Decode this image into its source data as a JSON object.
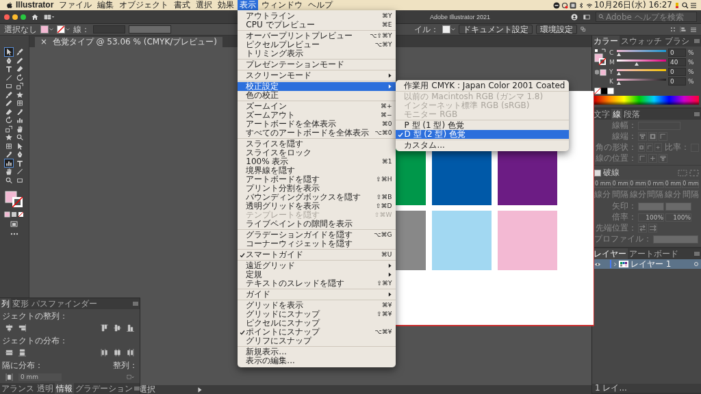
{
  "menubar": {
    "app": "Illustrator",
    "items": [
      {
        "label": "ファイル",
        "selected": false
      },
      {
        "label": "編集",
        "selected": false
      },
      {
        "label": "オブジェクト",
        "selected": false
      },
      {
        "label": "書式",
        "selected": false
      },
      {
        "label": "選択",
        "selected": false
      },
      {
        "label": "効果",
        "selected": false
      },
      {
        "label": "表示",
        "selected": true
      },
      {
        "label": "ウィンドウ",
        "selected": false
      },
      {
        "label": "ヘルプ",
        "selected": false
      }
    ],
    "clock": "10月26日(水) 16:27"
  },
  "view_menu": {
    "groups": [
      [
        {
          "label": "アウトライン",
          "shortcut": "⌘Y",
          "submenu": false,
          "checked": false,
          "disabled": false,
          "selected": false
        },
        {
          "label": "CPU でプレビュー",
          "shortcut": "⌘E",
          "submenu": false,
          "checked": false,
          "disabled": false,
          "selected": false
        }
      ],
      [
        {
          "label": "オーバープリントプレビュー",
          "shortcut": "⌥⇧⌘Y",
          "submenu": false,
          "checked": false,
          "disabled": false,
          "selected": false
        },
        {
          "label": "ピクセルプレビュー",
          "shortcut": "⌥⌘Y",
          "submenu": false,
          "checked": false,
          "disabled": false,
          "selected": false
        },
        {
          "label": "トリミング表示",
          "submenu": false,
          "checked": false,
          "disabled": false,
          "selected": false
        }
      ],
      [
        {
          "label": "プレゼンテーションモード",
          "submenu": false,
          "checked": false,
          "disabled": false,
          "selected": false
        }
      ],
      [
        {
          "label": "スクリーンモード",
          "submenu": true,
          "checked": false,
          "disabled": false,
          "selected": false
        }
      ],
      [
        {
          "label": "校正設定",
          "submenu": true,
          "checked": false,
          "disabled": false,
          "selected": true
        },
        {
          "label": "色の校正",
          "submenu": false,
          "checked": false,
          "disabled": false,
          "selected": false
        }
      ],
      [
        {
          "label": "ズームイン",
          "shortcut": "⌘+",
          "submenu": false,
          "checked": false,
          "disabled": false,
          "selected": false
        },
        {
          "label": "ズームアウト",
          "shortcut": "⌘−",
          "submenu": false,
          "checked": false,
          "disabled": false,
          "selected": false
        },
        {
          "label": "アートボードを全体表示",
          "shortcut": "⌘0",
          "submenu": false,
          "checked": false,
          "disabled": false,
          "selected": false
        },
        {
          "label": "すべてのアートボードを全体表示",
          "shortcut": "⌥⌘0",
          "submenu": false,
          "checked": false,
          "disabled": false,
          "selected": false
        }
      ],
      [
        {
          "label": "スライスを隠す",
          "submenu": false,
          "checked": false,
          "disabled": false,
          "selected": false
        },
        {
          "label": "スライスをロック",
          "submenu": false,
          "checked": false,
          "disabled": false,
          "selected": false
        },
        {
          "label": "100% 表示",
          "shortcut": "⌘1",
          "submenu": false,
          "checked": false,
          "disabled": false,
          "selected": false
        },
        {
          "label": "境界線を隠す",
          "submenu": false,
          "checked": false,
          "disabled": false,
          "selected": false
        },
        {
          "label": "アートボードを隠す",
          "shortcut": "⇧⌘H",
          "submenu": false,
          "checked": false,
          "disabled": false,
          "selected": false
        },
        {
          "label": "プリント分割を表示",
          "submenu": false,
          "checked": false,
          "disabled": false,
          "selected": false
        },
        {
          "label": "バウンディングボックスを隠す",
          "shortcut": "⇧⌘B",
          "submenu": false,
          "checked": false,
          "disabled": false,
          "selected": false
        },
        {
          "label": "透明グリッドを表示",
          "shortcut": "⇧⌘D",
          "submenu": false,
          "checked": false,
          "disabled": false,
          "selected": false
        },
        {
          "label": "テンプレートを隠す",
          "shortcut": "⇧⌘W",
          "submenu": false,
          "checked": false,
          "disabled": true,
          "selected": false
        },
        {
          "label": "ライブペイントの隙間を表示",
          "submenu": false,
          "checked": false,
          "disabled": false,
          "selected": false
        }
      ],
      [
        {
          "label": "グラデーションガイドを隠す",
          "shortcut": "⌥⌘G",
          "submenu": false,
          "checked": false,
          "disabled": false,
          "selected": false
        },
        {
          "label": "コーナーウィジェットを隠す",
          "submenu": false,
          "checked": false,
          "disabled": false,
          "selected": false
        }
      ],
      [
        {
          "label": "スマートガイド",
          "shortcut": "⌘U",
          "submenu": false,
          "checked": true,
          "disabled": false,
          "selected": false
        }
      ],
      [
        {
          "label": "遠近グリッド",
          "submenu": true,
          "checked": false,
          "disabled": false,
          "selected": false
        },
        {
          "label": "定規",
          "submenu": true,
          "checked": false,
          "disabled": false,
          "selected": false
        },
        {
          "label": "テキストのスレッドを隠す",
          "shortcut": "⇧⌘Y",
          "submenu": false,
          "checked": false,
          "disabled": false,
          "selected": false
        }
      ],
      [
        {
          "label": "ガイド",
          "submenu": true,
          "checked": false,
          "disabled": false,
          "selected": false
        }
      ],
      [
        {
          "label": "グリッドを表示",
          "shortcut": "⌘¥",
          "submenu": false,
          "checked": false,
          "disabled": false,
          "selected": false
        },
        {
          "label": "グリッドにスナップ",
          "shortcut": "⇧⌘¥",
          "submenu": false,
          "checked": false,
          "disabled": false,
          "selected": false
        },
        {
          "label": "ピクセルにスナップ",
          "submenu": false,
          "checked": false,
          "disabled": false,
          "selected": false
        },
        {
          "label": "ポイントにスナップ",
          "shortcut": "⌥⌘¥",
          "submenu": false,
          "checked": true,
          "disabled": false,
          "selected": false
        },
        {
          "label": "グリフにスナップ",
          "submenu": false,
          "checked": false,
          "disabled": false,
          "selected": false
        }
      ],
      [
        {
          "label": "新規表示...",
          "submenu": false,
          "checked": false,
          "disabled": false,
          "selected": false
        },
        {
          "label": "表示の編集...",
          "submenu": false,
          "checked": false,
          "disabled": false,
          "selected": false
        }
      ]
    ],
    "submenu": {
      "groups": [
        [
          {
            "label": "作業用 CMYK : Japan Color 2001 Coated",
            "checked": false,
            "disabled": false,
            "selected": false
          }
        ],
        [
          {
            "label": "以前の Macintosh RGB (ガンマ 1.8)",
            "checked": false,
            "disabled": true,
            "selected": false
          },
          {
            "label": "インターネット標準 RGB (sRGB)",
            "checked": false,
            "disabled": true,
            "selected": false
          },
          {
            "label": "モニター RGB",
            "checked": false,
            "disabled": true,
            "selected": false
          }
        ],
        [
          {
            "label": "P 型 (1 型) 色覚",
            "checked": false,
            "disabled": false,
            "selected": false
          },
          {
            "label": "D 型 (2 型) 色覚",
            "checked": true,
            "disabled": false,
            "selected": true
          }
        ],
        [
          {
            "label": "カスタム...",
            "checked": false,
            "disabled": false,
            "selected": false
          }
        ]
      ]
    }
  },
  "window": {
    "title": "Adobe Illustrator 2021",
    "search": {
      "placeholder": "Adobe ヘルプを検索"
    }
  },
  "control_bar": {
    "selection": "選択なし",
    "stroke_label": "線：",
    "style_label": "イル：",
    "buttons": [
      "ドキュメント設定",
      "環境設定"
    ]
  },
  "document_tab": {
    "close": "×",
    "title": "色覚タイプ @ 53.06 % (CMYK/プレビュー)"
  },
  "tools": [
    {
      "selected": true
    },
    {
      "selected": false
    },
    {
      "selected": false
    },
    {
      "selected": false
    },
    {
      "selected": false
    },
    {
      "selected": false
    },
    {
      "selected": false
    },
    {
      "selected": false
    },
    {
      "selected": false
    },
    {
      "selected": false
    },
    {
      "selected": false
    },
    {
      "selected": false
    },
    {
      "selected": false
    },
    {
      "selected": false
    },
    {
      "selected": false
    },
    {
      "selected": false
    },
    {
      "selected": false
    },
    {
      "selected": false
    },
    {
      "selected": false
    },
    {
      "selected": false
    },
    {
      "selected": false
    },
    {
      "selected": false
    },
    {
      "selected": false
    },
    {
      "selected": false
    },
    {
      "selected": false
    },
    {
      "selected": false
    },
    {
      "selected": true
    },
    {
      "selected": false
    },
    {
      "selected": false
    },
    {
      "selected": false
    },
    {
      "selected": false
    },
    {
      "selected": false
    }
  ],
  "artboard": {
    "swatches": [
      {
        "color": "#00974a"
      },
      {
        "color": "#0059a8"
      },
      {
        "color": "#6c1c84"
      },
      {
        "color": "#888888"
      },
      {
        "color": "#a2d8f2"
      },
      {
        "color": "#f3b9d3"
      }
    ]
  },
  "color_panel": {
    "tabs": [
      {
        "label": "カラー",
        "selected": true
      },
      {
        "label": "スウォッチ",
        "selected": false
      },
      {
        "label": "ブラシ",
        "selected": false
      }
    ],
    "channels": [
      {
        "name": "C",
        "value": "0",
        "unit": "%",
        "level": 0
      },
      {
        "name": "M",
        "value": "40",
        "unit": "%",
        "level": 0.4
      },
      {
        "name": "Y",
        "value": "0",
        "unit": "%",
        "level": 0
      },
      {
        "name": "K",
        "value": "0",
        "unit": "%",
        "level": 0
      }
    ]
  },
  "stroke_panel": {
    "disabled": true,
    "tabs": [
      {
        "label": "文字",
        "selected": false
      },
      {
        "label": "線",
        "selected": true
      },
      {
        "label": "段落",
        "selected": false
      }
    ],
    "weight_label": "線幅：",
    "cap_label": "線端：",
    "corner_label": "角の形状：",
    "limit_label": "比率：",
    "align_label": "線の位置：",
    "dash": {
      "label": "破線",
      "checked": false
    },
    "dash_fields": [
      {
        "value": "0 mm",
        "label": "線分"
      },
      {
        "value": "0 mm",
        "label": "間隔"
      },
      {
        "value": "0 mm",
        "label": "線分"
      },
      {
        "value": "0 mm",
        "label": "間隔"
      },
      {
        "value": "0 mm",
        "label": "線分"
      },
      {
        "value": "0 mm",
        "label": "間隔"
      }
    ],
    "arrow_label": "矢印：",
    "scale_label": "倍率：",
    "scales": [
      "100%",
      "100%"
    ],
    "tip_label": "先端位置：",
    "profile_label": "プロファイル："
  },
  "layers_panel": {
    "tabs": [
      {
        "label": "レイヤー",
        "selected": true
      },
      {
        "label": "アートボード",
        "selected": false
      }
    ],
    "layers": [
      {
        "name": "レイヤー 1",
        "selected": true
      }
    ],
    "status": "1 レイ..."
  },
  "align_panel": {
    "tabs": [
      {
        "label": "列",
        "selected": true
      },
      {
        "label": "変形",
        "selected": false
      },
      {
        "label": "パスファインダー",
        "selected": false
      }
    ],
    "align_label": "ジェクトの整列：",
    "distribute_label": "ジェクトの分布：",
    "spacing_label": "隔に分布：",
    "align_to_label": "整列：",
    "spacing_value": "0 mm",
    "bottom_tabs": [
      {
        "label": "アランス",
        "selected": false
      },
      {
        "label": "透明",
        "selected": false
      },
      {
        "label": "情報",
        "selected": true
      },
      {
        "label": "グラデーション",
        "selected": false
      }
    ]
  },
  "status_bar": {
    "tool": "選択"
  }
}
